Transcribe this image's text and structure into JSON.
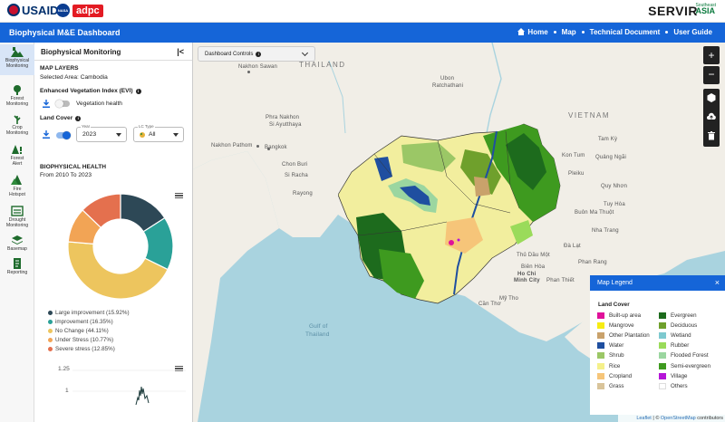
{
  "logos": {
    "usaid": "USAID",
    "nasa": "NASA",
    "adpc": "adpc",
    "servir": "SERVIR",
    "servir_sub_top": "Southeast",
    "servir_sub_bottom": "ASIA"
  },
  "header": {
    "title": "Biophysical M&E Dashboard",
    "nav": [
      "Home",
      "Map",
      "Technical Document",
      "User Guide"
    ]
  },
  "rail": [
    {
      "label_1": "Biophysical",
      "label_2": "Monitoring",
      "icon": "landscape-icon"
    },
    {
      "label_1": "Forest",
      "label_2": "Monitoring",
      "icon": "tree-icon"
    },
    {
      "label_1": "Crop",
      "label_2": "Monitoring",
      "icon": "crop-icon"
    },
    {
      "label_1": "Forest",
      "label_2": "Alert",
      "icon": "forest-alert-icon"
    },
    {
      "label_1": "Fire",
      "label_2": "Hotspot",
      "icon": "fire-icon"
    },
    {
      "label_1": "Drought",
      "label_2": "Monitoring",
      "icon": "drought-icon"
    },
    {
      "label_1": "Basemap",
      "label_2": "",
      "icon": "layers-icon"
    },
    {
      "label_1": "Reporting",
      "label_2": "",
      "icon": "report-icon"
    }
  ],
  "panel": {
    "title": "Biophysical Monitoring",
    "collapse": "|<",
    "map_layers": "MAP LAYERS",
    "selected_area": "Selected Area: Cambodia",
    "evi_title": "Enhanced Vegetation Index (EVI)",
    "evi_toggle_label": "Vegetation health",
    "land_cover_title": "Land Cover",
    "year_label": "Year",
    "year_value": "2023",
    "lc_type_label": "LC Type",
    "lc_type_value": "All",
    "health_title": "BIOPHYSICAL HEALTH",
    "health_range": "From 2010 To 2023",
    "line_chart_y1": "1.25",
    "line_chart_y2": "1"
  },
  "chart_data": {
    "type": "pie",
    "categories": [
      "Large improvement",
      "improvement",
      "No Change",
      "Under Stress",
      "Severe stress"
    ],
    "values": [
      15.92,
      16.35,
      44.11,
      10.77,
      12.85
    ],
    "legend_labels": [
      "Large improvement (15.92%)",
      "improvement (16.35%)",
      "No Change (44.11%)",
      "Under Stress (10.77%)",
      "Severe stress (12.85%)"
    ],
    "colors": [
      "#2d4856",
      "#2aa198",
      "#edc55e",
      "#f2a455",
      "#e4704e"
    ],
    "donut": true
  },
  "map": {
    "dashboard_controls": "Dashboard Controls",
    "labels": {
      "thailand": "THAILAND",
      "vietnam": "VIETNAM",
      "gulf1": "Gulf of",
      "gulf2": "Thailand",
      "nakhon_sawan": "Nakhon Sawan",
      "ubon": "Ubon",
      "ratchathani": "Ratchathani",
      "phitsanulok": "Phra Nakhon",
      "si_ayutthaya": "Si Ayutthaya",
      "nakhon_pathom": "Nakhon Pathom",
      "bangkok": "Bangkok",
      "chon_buri": "Chon Buri",
      "si_racha": "Si Racha",
      "rayong": "Rayong",
      "kon_tum": "Kon Tum",
      "pleiku": "Pleiku",
      "ban_me_thuot": "Buôn Ma Thuột",
      "phan_rang": "Phan Rang",
      "da_lat": "Đà Lạt",
      "phan_thiet": "Phan Thiết",
      "tam_ky": "Tam Kỳ",
      "quang_ngai": "Quảng Ngãi",
      "quy_nhon": "Quy Nhơn",
      "tuy_hoa": "Tuy Hòa",
      "nha_trang": "Nha Trang",
      "ho_chi_minh": "Ho Chi",
      "minh_city": "Minh City",
      "thu_dau_mot": "Thủ Dầu Một",
      "bien_hoa": "Biên Hòa",
      "can_tho": "Cần Thơ",
      "my_tho": "Mỹ Tho"
    }
  },
  "legend": {
    "title": "Map Legend",
    "close": "×",
    "land_cover_title": "Land Cover",
    "left": [
      {
        "label": "Built-up area",
        "color": "#e0119a"
      },
      {
        "label": "Mangrove",
        "color": "#f7ec12"
      },
      {
        "label": "Other Plantation",
        "color": "#c9a26b"
      },
      {
        "label": "Water",
        "color": "#1f4fa0"
      },
      {
        "label": "Shrub",
        "color": "#9bc766"
      },
      {
        "label": "Rice",
        "color": "#f5f08a"
      },
      {
        "label": "Cropland",
        "color": "#f6c579"
      },
      {
        "label": "Grass",
        "color": "#d9c49a"
      }
    ],
    "right": [
      {
        "label": "Evergreen",
        "color": "#1d6b1d"
      },
      {
        "label": "Deciduous",
        "color": "#6fa02c"
      },
      {
        "label": "Wetland",
        "color": "#7ec9cf"
      },
      {
        "label": "Rubber",
        "color": "#9adb5a"
      },
      {
        "label": "Flooded Forest",
        "color": "#9bd6a0"
      },
      {
        "label": "Semi-evergreen",
        "color": "#3e9a1f"
      },
      {
        "label": "Village",
        "color": "#b514d8"
      },
      {
        "label": "Others",
        "color": "#ffffff"
      }
    ]
  },
  "attribution": {
    "leaflet": "Leaflet",
    "sep": " | © ",
    "osm": "OpenStreetMap",
    "contrib": " contributors"
  }
}
